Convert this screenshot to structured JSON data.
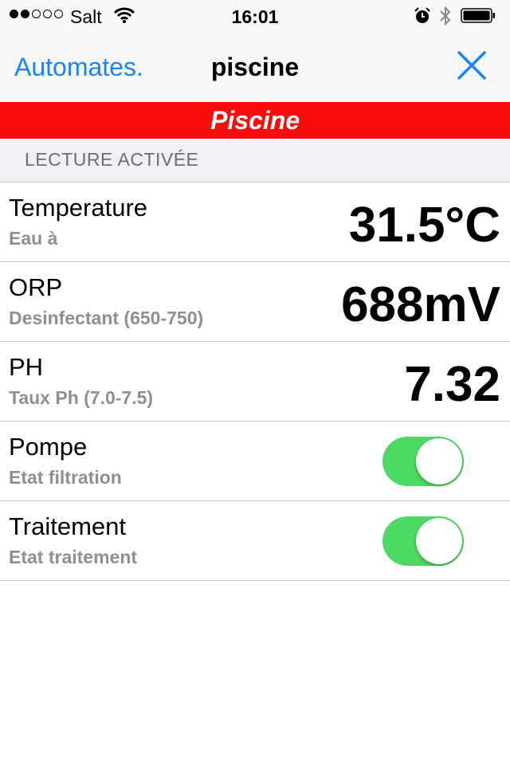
{
  "status_bar": {
    "carrier": "Salt",
    "time": "16:01",
    "signal_bars_filled": 2,
    "signal_bars_total": 5
  },
  "nav": {
    "back_label": "Automates.",
    "title": "piscine",
    "close_icon": "close-icon"
  },
  "banner": {
    "title": "Piscine",
    "color": "#fa0c0d"
  },
  "section": {
    "title": "LECTURE ACTIVÉE"
  },
  "readings": [
    {
      "title": "Temperature",
      "subtitle": "Eau à",
      "value": "31.5°C"
    },
    {
      "title": "ORP",
      "subtitle": "Desinfectant (650-750)",
      "value": "688mV"
    },
    {
      "title": "PH",
      "subtitle": "Taux Ph (7.0-7.5)",
      "value": "7.32"
    }
  ],
  "toggles": [
    {
      "title": "Pompe",
      "subtitle": "Etat filtration",
      "on": true
    },
    {
      "title": "Traitement",
      "subtitle": "Etat traitement",
      "on": true
    }
  ],
  "colors": {
    "accent": "#1a84ef",
    "toggle_on": "#4cd964",
    "banner": "#fa0c0d"
  }
}
